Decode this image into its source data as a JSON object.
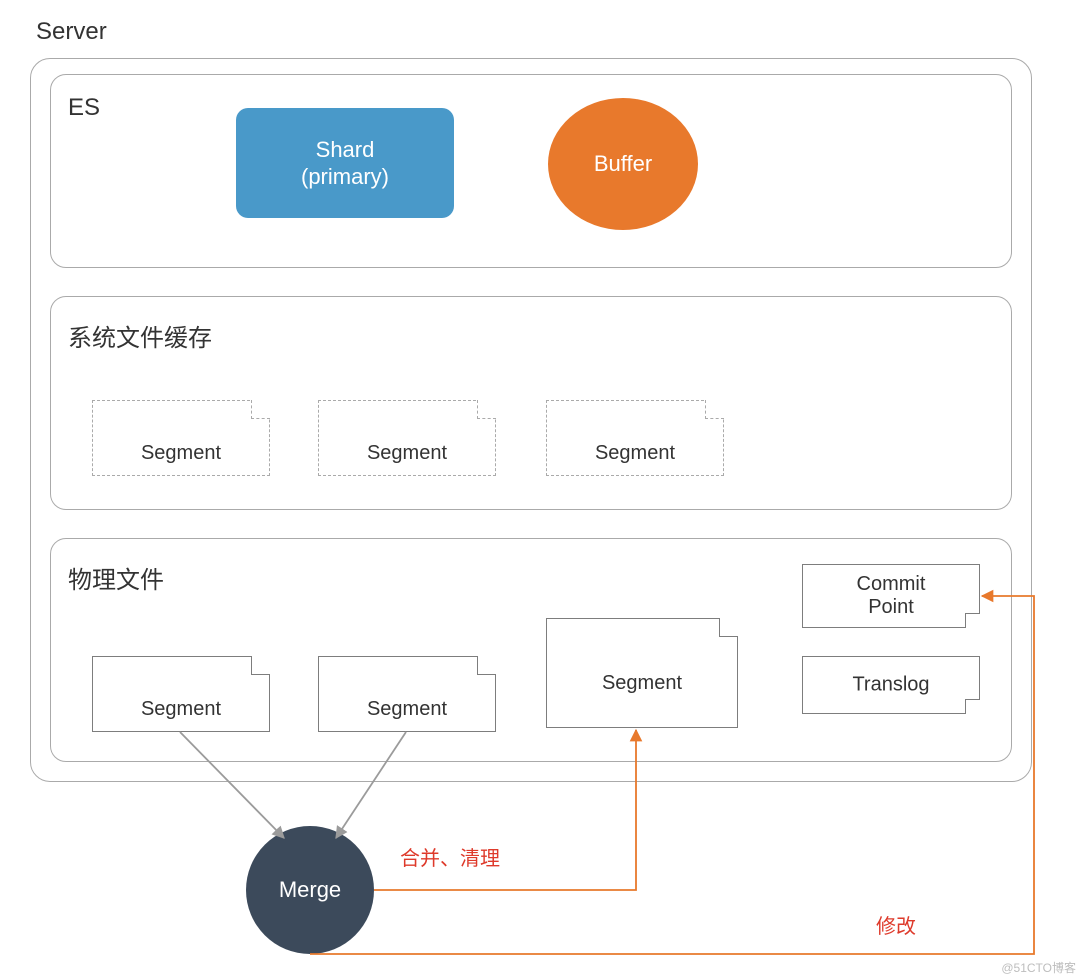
{
  "title": "Server",
  "es": {
    "label": "ES",
    "shard_line1": "Shard",
    "shard_line2": "(primary)",
    "buffer": "Buffer"
  },
  "cache": {
    "label": "系统文件缓存",
    "segments": [
      "Segment",
      "Segment",
      "Segment"
    ]
  },
  "phys": {
    "label": "物理文件",
    "segments": [
      "Segment",
      "Segment",
      "Segment"
    ],
    "commit_point_line1": "Commit",
    "commit_point_line2": "Point",
    "translog": "Translog"
  },
  "merge": {
    "label": "Merge",
    "arrow1_label": "合并、清理",
    "arrow2_label": "修改"
  },
  "watermark": "@51CTO博客"
}
